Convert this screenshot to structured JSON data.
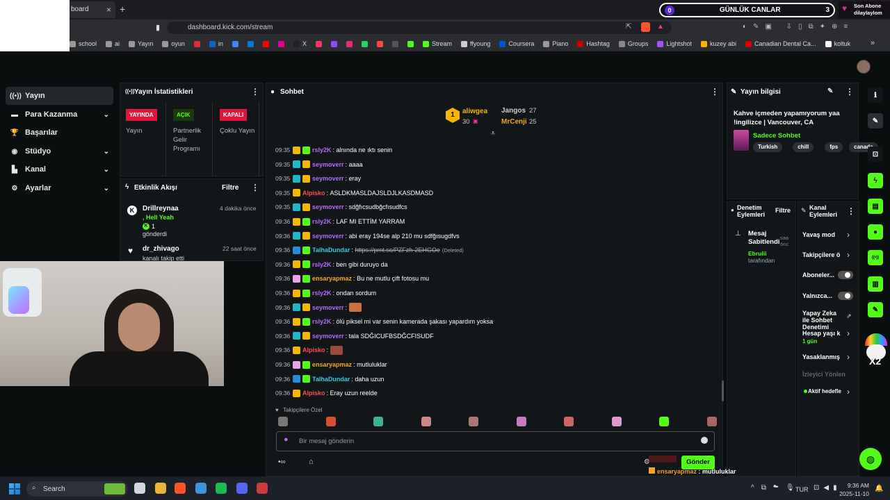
{
  "browser": {
    "tab_label": "board",
    "url": "dashboard.kick.com/stream",
    "new_tab": "+",
    "bookmarks": [
      {
        "label": "school",
        "color": "#999"
      },
      {
        "label": "ai",
        "color": "#999"
      },
      {
        "label": "Yayın",
        "color": "#999"
      },
      {
        "label": "oyun",
        "color": "#999"
      },
      {
        "label": "",
        "color": "#e02b3c"
      },
      {
        "label": "in",
        "color": "#0a66c2"
      },
      {
        "label": "",
        "color": "#4285f4"
      },
      {
        "label": "",
        "color": "#0078d4"
      },
      {
        "label": "",
        "color": "#ff0000"
      },
      {
        "label": "",
        "color": "#e10098"
      },
      {
        "label": "X",
        "color": "#222"
      },
      {
        "label": "",
        "color": "#ff3366"
      },
      {
        "label": "",
        "color": "#9146ff"
      },
      {
        "label": "",
        "color": "#e1306c"
      },
      {
        "label": "",
        "color": "#25d366"
      },
      {
        "label": "",
        "color": "#ff4444"
      },
      {
        "label": "",
        "color": "#555"
      },
      {
        "label": "",
        "color": "#53fc18"
      },
      {
        "label": "Stream",
        "color": "#53fc18"
      },
      {
        "label": "ffyoung",
        "color": "#ccc"
      },
      {
        "label": "Coursera",
        "color": "#0056d2"
      },
      {
        "label": "Piano",
        "color": "#999"
      },
      {
        "label": "Hashtag",
        "color": "#c00"
      },
      {
        "label": "Groups",
        "color": "#888"
      },
      {
        "label": "Lightshot",
        "color": "#a050ff"
      },
      {
        "label": "kuzey abi",
        "color": "#f4b400"
      },
      {
        "label": "Canadian Dental Ca...",
        "color": "#d00"
      },
      {
        "label": "koltuk",
        "color": "#fff"
      }
    ]
  },
  "overlay": {
    "canlar_label": "GÜNLÜK CANLAR",
    "canlar_left": "0",
    "canlar_right": "3",
    "abone_title": "Son Abone",
    "abone_name": "dilaylaylom"
  },
  "sidebar": {
    "items": [
      {
        "label": "Yayın",
        "icon": "broadcast-icon",
        "glyph": "((•))"
      },
      {
        "label": "Para Kazanma",
        "icon": "money-icon",
        "glyph": "▬"
      },
      {
        "label": "Başarılar",
        "icon": "trophy-icon",
        "glyph": "🏆"
      },
      {
        "label": "Stüdyo",
        "icon": "studio-icon",
        "glyph": "◉"
      },
      {
        "label": "Kanal",
        "icon": "channel-icon",
        "glyph": "▙"
      },
      {
        "label": "Ayarlar",
        "icon": "gear-icon",
        "glyph": "⚙"
      }
    ]
  },
  "stats": {
    "title": "Yayın İstatistikleri",
    "cols": [
      {
        "badge": "YAYINDA",
        "label": "Yayın",
        "color": "#e1173f"
      },
      {
        "badge": "AÇIK",
        "label": "Partnerlik Gelir Programı",
        "color": "#53fc18"
      },
      {
        "badge": "KAPALI",
        "label": "Çoklu Yayın",
        "color": "#e1173f"
      }
    ]
  },
  "activity": {
    "title": "Etkinlik Akışı",
    "filter": "Filtre",
    "items": [
      {
        "name": "Drillreynaa",
        "time": "4 dakika önce",
        "line1": ", Hell Yeah",
        "count": "1",
        "line2": "gönderdi"
      },
      {
        "name": "dr_zhivago",
        "time": "22 saat önce",
        "line1": "kanalı takip etti"
      }
    ]
  },
  "chat": {
    "title": "Sohbet",
    "top_users": [
      {
        "name": "aliwgea",
        "count": "30"
      },
      {
        "name": "Jangos",
        "count": "27"
      },
      {
        "name": "MrCenji",
        "count": "25"
      }
    ],
    "messages": [
      {
        "time": "09:35",
        "user": "rsly2K",
        "ucolor": "#b36bff",
        "text": "alnında ne ıktı senin",
        "b1": "#f5b800",
        "b2": "#53fc18"
      },
      {
        "time": "09:35",
        "user": "seymoverr",
        "ucolor": "#b36bff",
        "text": "aaaa",
        "b1": "#1fb8c8",
        "b2": "#f5b800"
      },
      {
        "time": "09:35",
        "user": "seymoverr",
        "ucolor": "#b36bff",
        "text": "eray",
        "b1": "#1fb8c8",
        "b2": "#f5b800"
      },
      {
        "time": "09:35",
        "user": "Alpisko",
        "ucolor": "#ff4d4d",
        "text": "ASLDKMASLDAJSLDJLKASDMASD",
        "b1": "#f5b800",
        "b2": ""
      },
      {
        "time": "09:35",
        "user": "seymoverr",
        "ucolor": "#b36bff",
        "text": "sdğfıcsudbğcfısudfcs",
        "b1": "#1fb8c8",
        "b2": "#f5b800"
      },
      {
        "time": "09:36",
        "user": "rsly2K",
        "ucolor": "#b36bff",
        "text": "LAF MI ETTİM YARRAM",
        "b1": "#f5b800",
        "b2": "#53fc18"
      },
      {
        "time": "09:36",
        "user": "seymoverr",
        "ucolor": "#b36bff",
        "text": "abi eray 194se alp 210 mu sdfğısugdfvs",
        "b1": "#1fb8c8",
        "b2": "#f5b800"
      },
      {
        "time": "09:36",
        "user": "TalhaDundar",
        "ucolor": "#3cc8d8",
        "text": "https://prnt.sc/PZFzh-2EHGOe",
        "del": "(Deleted)",
        "b1": "#2a8bd8",
        "b2": "#53fc18"
      },
      {
        "time": "09:36",
        "user": "rsly2K",
        "ucolor": "#b36bff",
        "text": "ben gibi duruyo da",
        "b1": "#f5b800",
        "b2": "#53fc18"
      },
      {
        "time": "09:36",
        "user": "ensaryapmaz",
        "ucolor": "#f5a623",
        "text": "Bu ne mutlu çift fotosu mu",
        "b1": "#e7a4e8",
        "b2": "#53fc18"
      },
      {
        "time": "09:36",
        "user": "rsly2K",
        "ucolor": "#b36bff",
        "text": "ondan sordum",
        "b1": "#f5b800",
        "b2": "#53fc18"
      },
      {
        "time": "09:36",
        "user": "seymoverr",
        "ucolor": "#b36bff",
        "text": "",
        "emote": "#c9723b",
        "b1": "#1fb8c8",
        "b2": "#f5b800"
      },
      {
        "time": "09:36",
        "user": "rsly2K",
        "ucolor": "#b36bff",
        "text": "ölü piksel mi var senin kamerada şakası yapardım yoksa",
        "b1": "#f5b800",
        "b2": "#53fc18"
      },
      {
        "time": "09:36",
        "user": "seymoverr",
        "ucolor": "#b36bff",
        "text": "tala SDĞICUFBSDĞCFISUDF",
        "b1": "#1fb8c8",
        "b2": "#f5b800"
      },
      {
        "time": "09:36",
        "user": "Alpisko",
        "ucolor": "#ff4d4d",
        "text": "",
        "emote": "#9a4a3a",
        "b1": "#f5b800",
        "b2": ""
      },
      {
        "time": "09:36",
        "user": "ensaryapmaz",
        "ucolor": "#f5a623",
        "text": "mutluluklar",
        "b1": "#e7a4e8",
        "b2": "#53fc18"
      },
      {
        "time": "09:36",
        "user": "TalhaDundar",
        "ucolor": "#3cc8d8",
        "text": "daha uzun",
        "b1": "#2a8bd8",
        "b2": "#53fc18"
      },
      {
        "time": "09:36",
        "user": "Alpisko",
        "ucolor": "#ff4d4d",
        "text": "Eray uzun reelde",
        "b1": "#f5b800",
        "b2": ""
      }
    ],
    "followers_only": "Takipçilere Özel",
    "placeholder": "Bir mesaj gönderin",
    "send": "Gönder"
  },
  "info": {
    "title": "Yayın bilgisi",
    "stream_title": "Kahve içmeden yapamıyorum yaa !ingilizce | Vancouver, CA",
    "category": "Sadece Sohbet",
    "tags": [
      "Turkish",
      "chill",
      "fps",
      "canada"
    ]
  },
  "mod": {
    "title": "Denetim Eylemleri",
    "filter": "Filtre",
    "pinned_title": "Mesaj Sabitlendi",
    "pinned_time": "saa önc",
    "pinned_by_name": "Ebrulii",
    "pinned_by_rest": "tarafından"
  },
  "channel": {
    "title": "Kanal Eylemleri",
    "items": [
      {
        "label": "Yavaş mod"
      },
      {
        "label": "Takipçilere ö"
      },
      {
        "label": "Aboneler..."
      },
      {
        "label": "Yalnızca..."
      },
      {
        "label": "Yapay Zeka ile Sohbet Denetimi"
      },
      {
        "label": "Hesap yaşı k",
        "sub": "1 gün"
      },
      {
        "label": "Yasaklanmış"
      },
      {
        "label": "İzleyici Yönlendi"
      },
      {
        "label": "Aktif hedefle"
      }
    ]
  },
  "overlay_chat": [
    {
      "user": "ensaryapmaz",
      "text": "mutluluklar",
      "color": "#f5a623"
    },
    {
      "user": "TalhaDundar",
      "text": "daha uzun",
      "color": "#3cc8d8"
    },
    {
      "user": "Alpisko",
      "text": "Eray uzun reelde",
      "color": "#ff4d4d"
    }
  ],
  "overlay_x2": "X2",
  "taskbar": {
    "search": "Search",
    "lang": "TUR",
    "time": "9:36 AM",
    "date": "2025-11-10"
  }
}
